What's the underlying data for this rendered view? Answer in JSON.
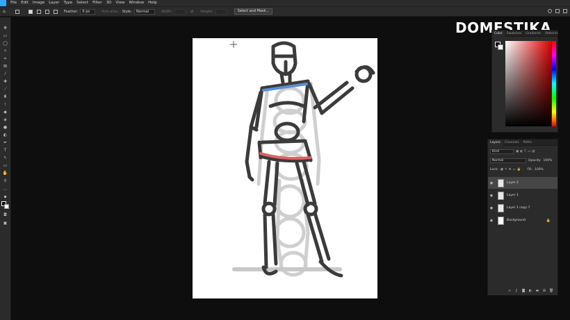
{
  "menubar": {
    "items": [
      "File",
      "Edit",
      "Image",
      "Layer",
      "Type",
      "Select",
      "Filter",
      "3D",
      "View",
      "Window",
      "Help"
    ]
  },
  "options": {
    "feather_label": "Feather:",
    "feather_value": "0 px",
    "antialias_label": "Anti-alias",
    "style_label": "Style:",
    "style_value": "Normal",
    "width_label": "Width:",
    "height_label": "Height:",
    "select_mask_label": "Select and Mask..."
  },
  "watermark": {
    "text": "DOMESTIKA"
  },
  "color_panel": {
    "tabs": [
      "Color",
      "Swatches",
      "Gradients",
      "Patterns"
    ],
    "foreground_color": "#000000",
    "background_color": "#ffffff",
    "hue_color": "#e00000"
  },
  "layers_panel": {
    "tabs": [
      "Layers",
      "Channels",
      "Paths"
    ],
    "filter_value": "Kind",
    "blend_mode": "Normal",
    "opacity_label": "Opacity:",
    "opacity_value": "100%",
    "lock_label": "Lock:",
    "fill_label": "Fill:",
    "fill_value": "100%",
    "layers": [
      {
        "name": "Layer 2",
        "selected": true
      },
      {
        "name": "Layer 1",
        "selected": false
      },
      {
        "name": "Layer 1 copy 7",
        "selected": false
      },
      {
        "name": "Background",
        "selected": false
      }
    ]
  },
  "icons": {
    "eye": "eye-icon",
    "lock": "lock-icon",
    "move": "move-tool-icon",
    "cursor": "crosshair-cursor-icon"
  }
}
